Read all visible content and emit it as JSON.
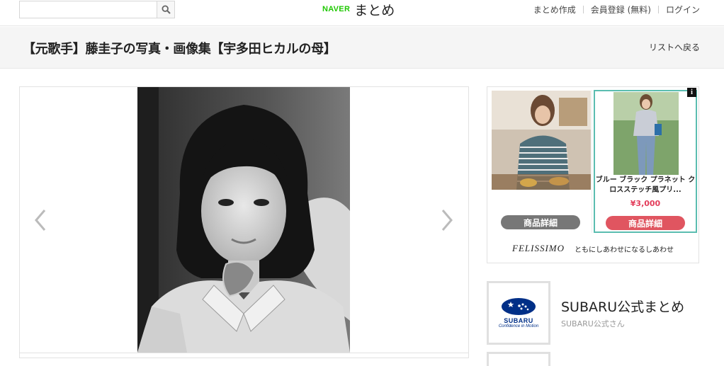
{
  "header": {
    "search_placeholder": "",
    "logo_naver": "NAVER",
    "logo_matome": "まとめ",
    "links": [
      "まとめ作成",
      "会員登録 (無料)",
      "ログイン"
    ]
  },
  "title_bar": {
    "title": "【元歌手】藤圭子の写真・画像集【宇多田ヒカルの母】",
    "back_label": "リストへ戻る"
  },
  "ad": {
    "items": [
      {
        "name": "",
        "price": "",
        "button": "商品詳細"
      },
      {
        "name": "ブルー ブラック プラネット クロスステッチ風プリ...",
        "price": "¥3,000",
        "button": "商品詳細"
      }
    ],
    "brand": "FELISSIMO",
    "tagline": "ともにしあわせになるしあわせ",
    "info": "i"
  },
  "promo": {
    "logo_name": "SUBARU",
    "logo_tag": "Confidence in Motion",
    "title": "SUBARU公式まとめ",
    "subtitle": "SUBARU公式さん"
  },
  "colors": {
    "naver_green": "#1ec800",
    "price": "#e33d5b",
    "ad_highlight": "#5bbdb0",
    "button_red": "#e05560",
    "button_gray": "#777777"
  }
}
